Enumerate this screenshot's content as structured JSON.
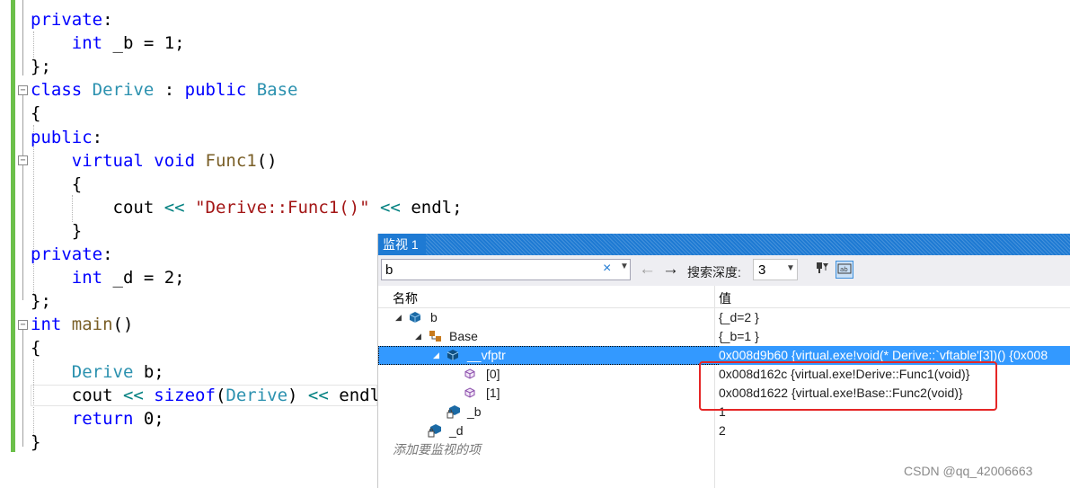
{
  "editor": {
    "lines": [
      {
        "segs": [
          {
            "c": "kw",
            "t": "private"
          },
          {
            "c": "pl",
            "t": ":"
          }
        ]
      },
      {
        "segs": [
          {
            "c": "pl",
            "t": "    "
          },
          {
            "c": "kw",
            "t": "int"
          },
          {
            "c": "pl",
            "t": " _b = 1;"
          }
        ]
      },
      {
        "segs": [
          {
            "c": "pl",
            "t": "};"
          }
        ]
      },
      {
        "segs": [
          {
            "c": "kw",
            "t": "class"
          },
          {
            "c": "pl",
            "t": " "
          },
          {
            "c": "ty",
            "t": "Derive"
          },
          {
            "c": "pl",
            "t": " : "
          },
          {
            "c": "kw",
            "t": "public"
          },
          {
            "c": "pl",
            "t": " "
          },
          {
            "c": "ty",
            "t": "Base"
          }
        ]
      },
      {
        "segs": [
          {
            "c": "pl",
            "t": "{"
          }
        ]
      },
      {
        "segs": [
          {
            "c": "kw",
            "t": "public"
          },
          {
            "c": "pl",
            "t": ":"
          }
        ]
      },
      {
        "segs": [
          {
            "c": "pl",
            "t": "    "
          },
          {
            "c": "kw",
            "t": "virtual"
          },
          {
            "c": "pl",
            "t": " "
          },
          {
            "c": "kw",
            "t": "void"
          },
          {
            "c": "pl",
            "t": " "
          },
          {
            "c": "fn",
            "t": "Func1"
          },
          {
            "c": "pl",
            "t": "()"
          }
        ]
      },
      {
        "segs": [
          {
            "c": "pl",
            "t": "    {"
          }
        ]
      },
      {
        "segs": [
          {
            "c": "pl",
            "t": "        cout "
          },
          {
            "c": "op",
            "t": "<<"
          },
          {
            "c": "pl",
            "t": " "
          },
          {
            "c": "str",
            "t": "\"Derive::Func1()\""
          },
          {
            "c": "pl",
            "t": " "
          },
          {
            "c": "op",
            "t": "<<"
          },
          {
            "c": "pl",
            "t": " endl;"
          }
        ]
      },
      {
        "segs": [
          {
            "c": "pl",
            "t": "    }"
          }
        ]
      },
      {
        "segs": [
          {
            "c": "kw",
            "t": "private"
          },
          {
            "c": "pl",
            "t": ":"
          }
        ]
      },
      {
        "segs": [
          {
            "c": "pl",
            "t": "    "
          },
          {
            "c": "kw",
            "t": "int"
          },
          {
            "c": "pl",
            "t": " _d = 2;"
          }
        ]
      },
      {
        "segs": [
          {
            "c": "pl",
            "t": "};"
          }
        ]
      },
      {
        "segs": [
          {
            "c": "kw",
            "t": "int"
          },
          {
            "c": "pl",
            "t": " "
          },
          {
            "c": "fn",
            "t": "main"
          },
          {
            "c": "pl",
            "t": "()"
          }
        ]
      },
      {
        "segs": [
          {
            "c": "pl",
            "t": "{"
          }
        ]
      },
      {
        "segs": [
          {
            "c": "pl",
            "t": "    "
          },
          {
            "c": "ty",
            "t": "Derive"
          },
          {
            "c": "pl",
            "t": " b;"
          }
        ]
      },
      {
        "segs": [
          {
            "c": "pl",
            "t": "    cout "
          },
          {
            "c": "op",
            "t": "<<"
          },
          {
            "c": "pl",
            "t": " "
          },
          {
            "c": "kw",
            "t": "sizeof"
          },
          {
            "c": "pl",
            "t": "("
          },
          {
            "c": "ty",
            "t": "Derive"
          },
          {
            "c": "pl",
            "t": ") "
          },
          {
            "c": "op",
            "t": "<<"
          },
          {
            "c": "pl",
            "t": " endl;"
          }
        ]
      },
      {
        "segs": [
          {
            "c": "pl",
            "t": "    "
          },
          {
            "c": "kw",
            "t": "return"
          },
          {
            "c": "pl",
            "t": " 0;"
          }
        ]
      },
      {
        "segs": [
          {
            "c": "pl",
            "t": "}"
          }
        ]
      }
    ]
  },
  "watch": {
    "title": "监视 1",
    "search_value": "b",
    "search_clear_icon": "×",
    "depth_label": "搜索深度:",
    "depth_value": "3",
    "col_name": "名称",
    "col_value": "值",
    "rows": [
      {
        "name": "b",
        "value": "{_d=2 }",
        "icon": "object-icon"
      },
      {
        "name": "Base",
        "value": "{_b=1 }",
        "icon": "base-class-icon"
      },
      {
        "name": "__vfptr",
        "value": "0x008d9b60 {virtual.exe!void(* Derive::`vftable'[3])() {0x008",
        "icon": "pointer-icon"
      },
      {
        "name": "[0]",
        "value": "0x008d162c {virtual.exe!Derive::Func1(void)}",
        "icon": "method-icon"
      },
      {
        "name": "[1]",
        "value": "0x008d1622 {virtual.exe!Base::Func2(void)}",
        "icon": "method-icon"
      },
      {
        "name": "_b",
        "value": "1",
        "icon": "private-field-icon"
      },
      {
        "name": "_d",
        "value": "2",
        "icon": "private-field-icon"
      }
    ],
    "add_placeholder": "添加要监视的项"
  },
  "watermark": "CSDN @qq_42006663",
  "colors": {
    "accent": "#1e7ad3",
    "selection": "#3399ff",
    "highlight_box": "#e52626"
  }
}
